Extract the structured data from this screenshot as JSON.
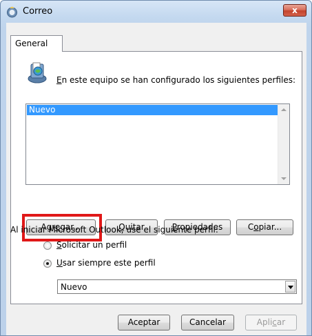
{
  "window": {
    "title": "Correo",
    "close_label": "x"
  },
  "tabs": [
    {
      "label": "General"
    }
  ],
  "profiles": {
    "intro_prefix": "E",
    "intro_rest": "n este equipo se han configurado los siguientes perfiles:",
    "items": [
      "Nuevo"
    ]
  },
  "buttons": {
    "add": {
      "prefix": "Agr",
      "accel": "e",
      "suffix": "gar..."
    },
    "remove": {
      "prefix": "",
      "accel": "Q",
      "suffix": "uitar"
    },
    "properties": {
      "prefix": "",
      "accel": "P",
      "suffix": "ropiedades"
    },
    "copy": {
      "prefix": "C",
      "accel": "o",
      "suffix": "piar..."
    }
  },
  "startup": {
    "label": "Al iniciar Microsoft Outlook, use el siguiente perfil:",
    "option_prompt": {
      "accel": "S",
      "rest": "olicitar un perfil",
      "selected": false
    },
    "option_always": {
      "accel": "U",
      "rest": "sar siempre este perfil",
      "selected": true
    },
    "selected_profile": "Nuevo"
  },
  "footer": {
    "ok": "Aceptar",
    "cancel": "Cancelar",
    "apply_prefix": "Apli",
    "apply_accel": "c",
    "apply_suffix": "ar"
  }
}
